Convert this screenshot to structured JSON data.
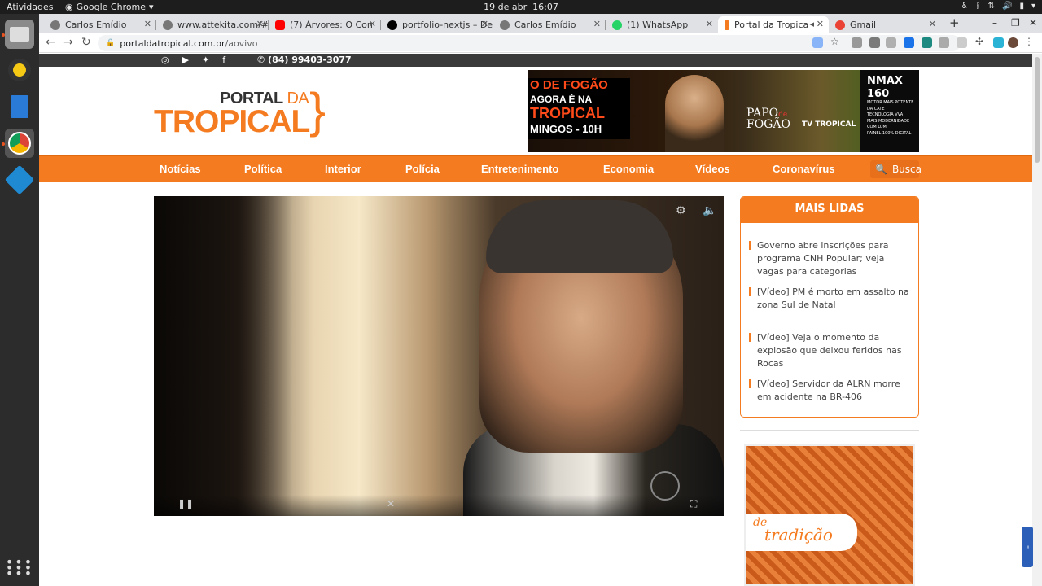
{
  "topbar": {
    "activities": "Atividades",
    "app_name": "Google Chrome",
    "date": "19 de abr",
    "time": "16:07"
  },
  "dock": {
    "items": [
      {
        "name": "Files"
      },
      {
        "name": "Rhythmbox"
      },
      {
        "name": "LibreOffice Writer"
      },
      {
        "name": "Google Chrome"
      },
      {
        "name": "Visual Studio Code"
      }
    ]
  },
  "tabs": [
    {
      "title": "Carlos Emídio",
      "favicon_color": "#5f6368"
    },
    {
      "title": "www.attekita.com/#",
      "favicon_color": "#5f6368"
    },
    {
      "title": "(7) Árvores: O Con",
      "favicon_color": "#ff0000"
    },
    {
      "title": "portfolio-nextjs – De",
      "favicon_color": "#000000"
    },
    {
      "title": "Carlos Emídio",
      "favicon_color": "#5f6368"
    },
    {
      "title": "(1) WhatsApp",
      "favicon_color": "#25d366"
    },
    {
      "title": "Portal da Tropica",
      "favicon_color": "#f47b20"
    },
    {
      "title": "Gmail",
      "favicon_color": "#ea4335"
    }
  ],
  "omnibox": {
    "domain": "portaldatropical.com.br",
    "path": "/aovivo"
  },
  "site": {
    "phone": "(84) 99403-3077",
    "logo_top": "PORTAL",
    "logo_da": "DA",
    "logo_main": "TROPICAL",
    "banner": {
      "line1": "O DE FOGÃO",
      "line2": "AGORA É NA",
      "line3": "TROPICAL",
      "line4": "MINGOS - 10H",
      "papo": "PAPO",
      "de": "de",
      "fogao": "FOGÃO",
      "tv": "TV TROPICAL",
      "nmax_title": "NMAX 160",
      "nmax_l1": "MOTOR MAIS POTENTE DA CATE",
      "nmax_l2": "TECNOLOGIA VVA",
      "nmax_l3": "MAIS MODERNIDADE COM LUM",
      "nmax_l4": "PAINEL 100% DIGITAL"
    },
    "nav": [
      "Notícias",
      "Política",
      "Interior",
      "Polícia",
      "Entretenimento",
      "Economia",
      "Vídeos",
      "Coronavírus"
    ],
    "search_label": "Busca",
    "mais_lidas": {
      "title": "MAIS LIDAS",
      "items": [
        "Governo abre inscrições para programa CNH Popular; veja vagas para categorias",
        "[Vídeo] PM é morto em assalto na zona Sul de Natal",
        "[Vídeo] Veja o momento da explosão que deixou feridos nas Rocas",
        "[Vídeo] Servidor da ALRN morre em acidente na BR-406"
      ]
    },
    "ad2": {
      "d": "de",
      "t": "tradição"
    }
  },
  "colors": {
    "brand_orange": "#f47b20",
    "dark_bar": "#3a3a3a"
  }
}
